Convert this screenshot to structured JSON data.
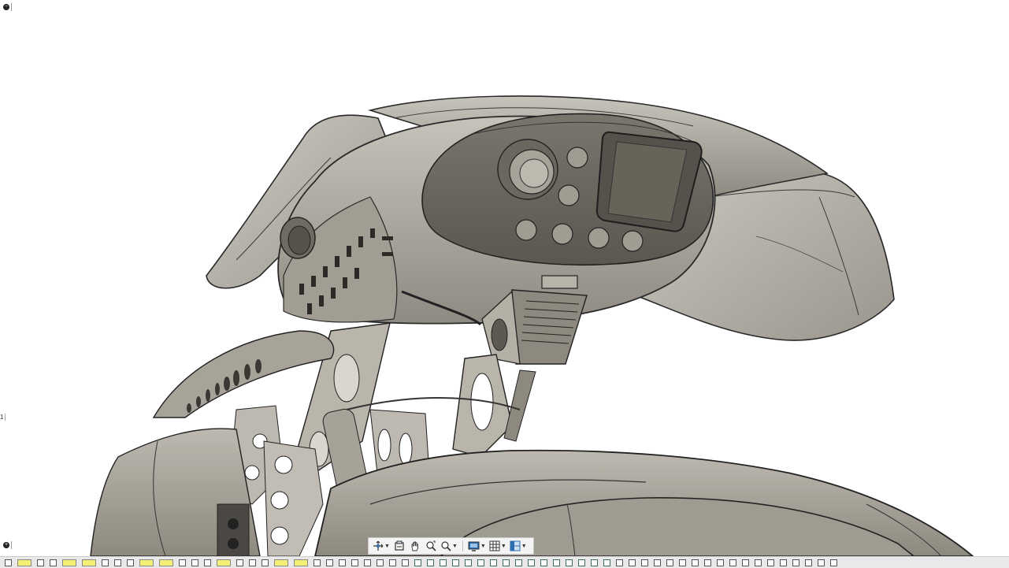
{
  "viewport": {
    "model": "robot-head-assembly",
    "colors": {
      "background": "#ffffff",
      "body": "#a9a59a",
      "body_light": "#c9c6bd",
      "body_dark": "#6e6a62",
      "edges": "#2a2a2a"
    }
  },
  "left_panels": {
    "browser_toggle_icon": "collapse-icon",
    "comments_toggle_icon": "add-icon",
    "marker": "1"
  },
  "nav_toolbar": {
    "items": [
      {
        "name": "orbit",
        "icon": "orbit-icon",
        "has_dropdown": true
      },
      {
        "name": "look-at",
        "icon": "look-at-icon",
        "has_dropdown": false
      },
      {
        "name": "pan",
        "icon": "pan-hand-icon",
        "has_dropdown": false
      },
      {
        "name": "zoom",
        "icon": "zoom-icon",
        "has_dropdown": false
      },
      {
        "name": "fit",
        "icon": "zoom-window-icon",
        "has_dropdown": true
      },
      {
        "name": "display-settings",
        "icon": "display-icon",
        "has_dropdown": true
      },
      {
        "name": "grid-snaps",
        "icon": "grid-icon",
        "has_dropdown": true
      },
      {
        "name": "viewports",
        "icon": "viewports-icon",
        "has_dropdown": true
      }
    ]
  },
  "timeline": {
    "highlight_color": "#f2ee76",
    "features": [
      "e",
      "h",
      "e",
      "e",
      "h",
      "h",
      "e",
      "e",
      "e",
      "h",
      "h",
      "e",
      "e",
      "e",
      "h",
      "e",
      "e",
      "e",
      "h",
      "h",
      "e",
      "e",
      "e",
      "e",
      "e",
      "e",
      "e",
      "e",
      "g",
      "g",
      "g",
      "g",
      "g",
      "g",
      "g",
      "g",
      "g",
      "g",
      "g",
      "g",
      "g",
      "g",
      "g",
      "g",
      "e",
      "e",
      "e",
      "e",
      "e",
      "e",
      "e",
      "e",
      "e",
      "e",
      "e",
      "e",
      "e",
      "e",
      "e",
      "e",
      "e",
      "e"
    ]
  }
}
